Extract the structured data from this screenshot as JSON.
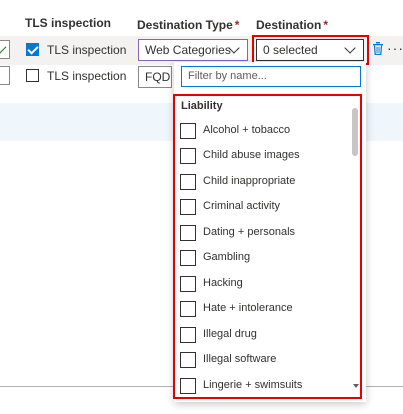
{
  "headers": {
    "tls": "TLS inspection",
    "dest_type": "Destination Type",
    "destination": "Destination",
    "required_mark": "*"
  },
  "rows": [
    {
      "tls_label": "TLS inspection",
      "tls_checked": true,
      "dest_type": "Web Categories",
      "destination": "0 selected"
    },
    {
      "tls_label": "TLS inspection",
      "tls_checked": false,
      "dest_type": "FQDN"
    }
  ],
  "dropdown": {
    "filter_placeholder": "Filter by name...",
    "group_label": "Liability",
    "items": [
      "Alcohol + tobacco",
      "Child abuse images",
      "Child inappropriate",
      "Criminal activity",
      "Dating + personals",
      "Gambling",
      "Hacking",
      "Hate + intolerance",
      "Illegal drug",
      "Illegal software",
      "Lingerie + swimsuits"
    ]
  },
  "colors": {
    "accent": "#0078d4",
    "highlight_box": "#e60000",
    "required": "#a4262c"
  },
  "icons": [
    "checkmark-icon",
    "chevron-down-icon",
    "trash-icon",
    "more-icon"
  ]
}
